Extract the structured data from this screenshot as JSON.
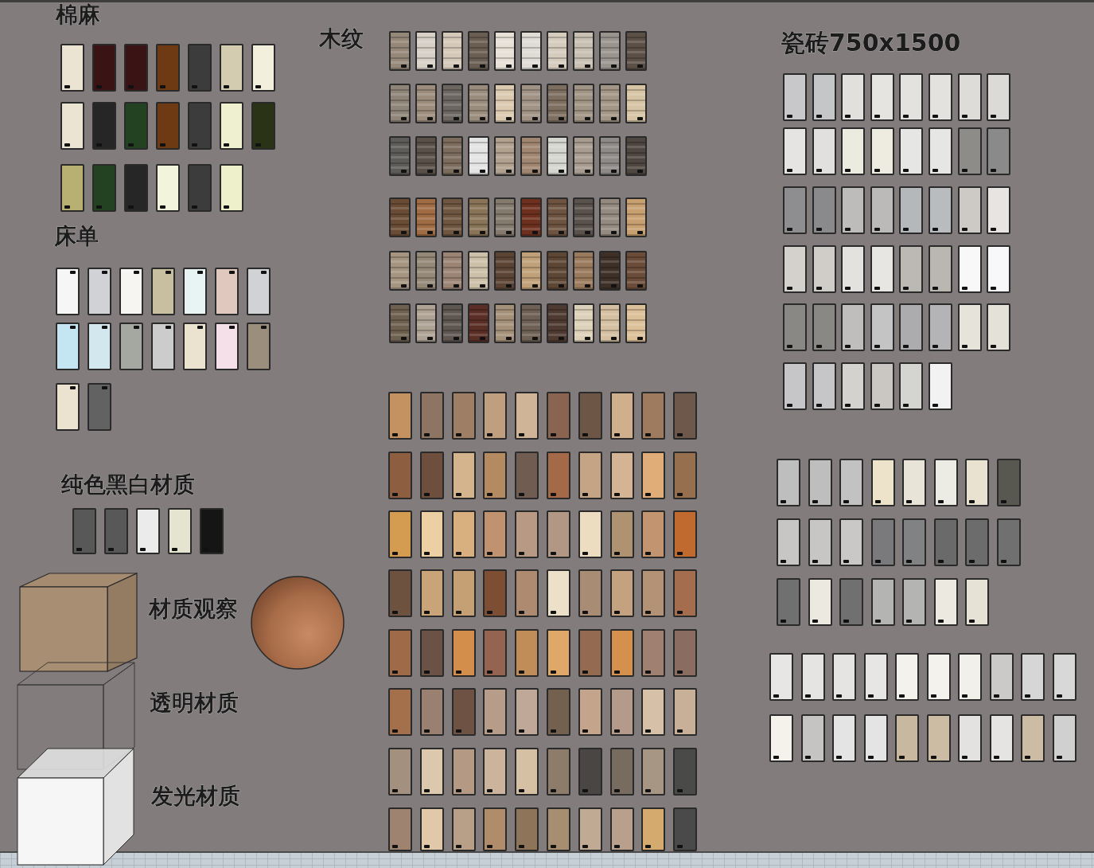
{
  "groups": [
    {
      "title": "棉麻",
      "kind": "flat",
      "rows": [
        [
          {
            "color": "#ece4d2"
          },
          {
            "color": "#3a1414"
          },
          {
            "color": "#3a1414"
          },
          {
            "color": "#6e3a14"
          },
          {
            "color": "#3c3c3c"
          },
          {
            "color": "#d3ccb0"
          },
          {
            "color": "#f2f0dc"
          }
        ],
        [
          {
            "color": "#ece4d2"
          },
          {
            "color": "#262626"
          },
          {
            "color": "#234222"
          },
          {
            "color": "#6e3a14"
          },
          {
            "color": "#3c3c3c"
          },
          {
            "color": "#eef0d0"
          },
          {
            "color": "#2a3316"
          }
        ],
        [
          {
            "color": "#b8b072"
          },
          {
            "color": "#234222"
          },
          {
            "color": "#262626"
          },
          {
            "color": "#f2f4dc"
          },
          {
            "color": "#3c3c3c"
          },
          {
            "color": "#eef0cc"
          }
        ]
      ]
    },
    {
      "title": "床单",
      "kind": "flat",
      "rows": [
        [
          {
            "color": "#f6f6f6"
          },
          {
            "color": "#d0d2d6"
          },
          {
            "color": "#f6f5f2"
          },
          {
            "color": "#c7bf9f"
          },
          {
            "color": "#e8f4f4"
          },
          {
            "color": "#e1c8bf"
          },
          {
            "color": "#d0d2d6"
          }
        ],
        [
          {
            "color": "#c4e6f2"
          },
          {
            "color": "#d2e8ee"
          },
          {
            "color": "#a4a8a0"
          },
          {
            "color": "#cccccc"
          },
          {
            "color": "#ebe3cf"
          },
          {
            "color": "#f5e0ea"
          },
          {
            "color": "#9b8e7c"
          }
        ],
        [
          {
            "color": "#ebe3cf"
          },
          {
            "color": "#626262"
          }
        ]
      ]
    },
    {
      "title": "纯色黑白材质",
      "kind": "flat",
      "rows": [
        [
          {
            "color": "#585858"
          },
          {
            "color": "#585858"
          },
          {
            "color": "#ebebeb"
          },
          {
            "color": "#e4e4d0"
          },
          {
            "color": "#151515"
          }
        ]
      ]
    },
    {
      "title": "木纹",
      "kind": "striped",
      "rows": [
        [
          {
            "color": "#958878"
          },
          {
            "color": "#d6d0c6"
          },
          {
            "color": "#d4c8b8"
          },
          {
            "color": "#6a5e52"
          },
          {
            "color": "#e6e0d6"
          },
          {
            "color": "#dedcd4"
          },
          {
            "color": "#d6ccbe"
          },
          {
            "color": "#c8c0b2"
          },
          {
            "color": "#9a948e"
          },
          {
            "color": "#5c5046"
          }
        ],
        [
          {
            "color": "#8e8478"
          },
          {
            "color": "#9c8c7c"
          },
          {
            "color": "#6c6660"
          },
          {
            "color": "#9a8c7c"
          },
          {
            "color": "#dccab0"
          },
          {
            "color": "#a09284"
          },
          {
            "color": "#7e6e60"
          },
          {
            "color": "#a09484"
          },
          {
            "color": "#a49686"
          },
          {
            "color": "#d6c4a4"
          }
        ],
        [
          {
            "color": "#5e5c58"
          },
          {
            "color": "#5a5048"
          },
          {
            "color": "#7c6c5e"
          },
          {
            "color": "#e4e4e4"
          },
          {
            "color": "#b0a08e"
          },
          {
            "color": "#a08670"
          },
          {
            "color": "#d6d6d0"
          },
          {
            "color": "#a89c90"
          },
          {
            "color": "#8e8a88"
          },
          {
            "color": "#4e4640"
          }
        ],
        [
          {
            "color": "#6a4c34"
          },
          {
            "color": "#a06c44"
          },
          {
            "color": "#6e5640"
          },
          {
            "color": "#8a7458"
          },
          {
            "color": "#847a6e"
          },
          {
            "color": "#6e301e"
          },
          {
            "color": "#6e5440"
          },
          {
            "color": "#5a524c"
          },
          {
            "color": "#948a80"
          },
          {
            "color": "#c8a070"
          }
        ],
        [
          {
            "color": "#a49480"
          },
          {
            "color": "#948878"
          },
          {
            "color": "#9c8474"
          },
          {
            "color": "#ccc0a8"
          },
          {
            "color": "#5c4434"
          },
          {
            "color": "#c0a078"
          },
          {
            "color": "#5e4634"
          },
          {
            "color": "#9a7a5c"
          },
          {
            "color": "#3e3026"
          },
          {
            "color": "#6a4c38"
          }
        ],
        [
          {
            "color": "#6e604e"
          },
          {
            "color": "#aea294"
          },
          {
            "color": "#5e5650"
          },
          {
            "color": "#5a2e24"
          },
          {
            "color": "#a49078"
          },
          {
            "color": "#6e6054"
          },
          {
            "color": "#4e3a30"
          },
          {
            "color": "#dcd0b8"
          },
          {
            "color": "#d4c0a0"
          },
          {
            "color": "#dcc098"
          }
        ]
      ]
    },
    {
      "kind": "flat",
      "rows": [
        [
          {
            "color": "#c49260"
          },
          {
            "color": "#8e7462"
          },
          {
            "color": "#9e7e64"
          },
          {
            "color": "#c09e80"
          },
          {
            "color": "#d0b498"
          },
          {
            "color": "#8a6450"
          },
          {
            "color": "#6e5646"
          },
          {
            "color": "#d0b08c"
          },
          {
            "color": "#9e7a5e"
          },
          {
            "color": "#6e584c"
          }
        ],
        [
          {
            "color": "#8e5e40"
          },
          {
            "color": "#6e4e3c"
          },
          {
            "color": "#d4b48c"
          },
          {
            "color": "#b48a60"
          },
          {
            "color": "#705c50"
          },
          {
            "color": "#a46a48"
          },
          {
            "color": "#c4a484"
          },
          {
            "color": "#d4b494"
          },
          {
            "color": "#e0ac78"
          },
          {
            "color": "#96704e"
          }
        ],
        [
          {
            "color": "#d49c50"
          },
          {
            "color": "#ecd0a4"
          },
          {
            "color": "#d8b080"
          },
          {
            "color": "#c09270"
          },
          {
            "color": "#b89a84"
          },
          {
            "color": "#b29884"
          },
          {
            "color": "#ecdcc0"
          },
          {
            "color": "#ae9272"
          },
          {
            "color": "#c29470"
          },
          {
            "color": "#c06a30"
          }
        ],
        [
          {
            "color": "#6e5240"
          },
          {
            "color": "#c8a478"
          },
          {
            "color": "#c4a074"
          },
          {
            "color": "#7e4e34"
          },
          {
            "color": "#ae8a70"
          },
          {
            "color": "#ece0c8"
          },
          {
            "color": "#a88c74"
          },
          {
            "color": "#c4a280"
          },
          {
            "color": "#b49276"
          },
          {
            "color": "#a46e4e"
          }
        ],
        [
          {
            "color": "#9e6a48"
          },
          {
            "color": "#6a5246"
          },
          {
            "color": "#d48e4c"
          },
          {
            "color": "#946450"
          },
          {
            "color": "#c08c58"
          },
          {
            "color": "#e0a868"
          },
          {
            "color": "#946a50"
          },
          {
            "color": "#d4904c"
          },
          {
            "color": "#a08070"
          },
          {
            "color": "#8a6c60"
          }
        ],
        [
          {
            "color": "#a4704c"
          },
          {
            "color": "#9a8070"
          },
          {
            "color": "#6e5244"
          },
          {
            "color": "#b89c8a"
          },
          {
            "color": "#c0a898"
          },
          {
            "color": "#74604e"
          },
          {
            "color": "#c4a48a"
          },
          {
            "color": "#b49a8a"
          },
          {
            "color": "#d6c0a8"
          },
          {
            "color": "#c8b098"
          }
        ],
        [
          {
            "color": "#a4907e"
          },
          {
            "color": "#dcc8ac"
          },
          {
            "color": "#b49a84"
          },
          {
            "color": "#ccb49c"
          },
          {
            "color": "#d6c0a4"
          },
          {
            "color": "#8e7c6a"
          },
          {
            "color": "#4a4644"
          },
          {
            "color": "#786c60"
          },
          {
            "color": "#a89684"
          },
          {
            "color": "#4a4a48"
          }
        ],
        [
          {
            "color": "#9e8470"
          },
          {
            "color": "#e0c8a8"
          },
          {
            "color": "#b8a088"
          },
          {
            "color": "#b08c6a"
          },
          {
            "color": "#8e7458"
          },
          {
            "color": "#a88e70"
          },
          {
            "color": "#c0aa94"
          },
          {
            "color": "#b8a08c"
          },
          {
            "color": "#d4aa6e"
          },
          {
            "color": "#4a4a4a"
          }
        ]
      ]
    },
    {
      "title": "瓷砖750x1500",
      "kind": "flat",
      "rows": [
        [
          {
            "color": "#c8c8ca"
          },
          {
            "color": "#c4c6c8"
          },
          {
            "color": "#e2e0dc"
          },
          {
            "color": "#e6e4e0"
          },
          {
            "color": "#e4e2de"
          },
          {
            "color": "#e4e2de"
          },
          {
            "color": "#dedcd8"
          },
          {
            "color": "#dcdad6"
          }
        ],
        [
          {
            "color": "#e6e4e2"
          },
          {
            "color": "#e2e0de"
          },
          {
            "color": "#ecebe0"
          },
          {
            "color": "#eeebe0"
          },
          {
            "color": "#e6e6e4"
          },
          {
            "color": "#e6e6e4"
          },
          {
            "color": "#8e8c88"
          },
          {
            "color": "#8a8a8a"
          }
        ],
        [
          {
            "color": "#8e8e90"
          },
          {
            "color": "#8a8a8c"
          },
          {
            "color": "#bebcba"
          },
          {
            "color": "#bcbab8"
          },
          {
            "color": "#b4b8ba"
          },
          {
            "color": "#b8bcbe"
          },
          {
            "color": "#cdc9c4"
          },
          {
            "color": "#e8e4e2"
          }
        ],
        [
          {
            "color": "#d4d0cc"
          },
          {
            "color": "#d0ccc8"
          },
          {
            "color": "#e4e2de"
          },
          {
            "color": "#e8e6e2"
          },
          {
            "color": "#bcb8b4"
          },
          {
            "color": "#bab6b0"
          },
          {
            "color": "#f8f8f8"
          },
          {
            "color": "#f8f8fa"
          }
        ],
        [
          {
            "color": "#8a8884"
          },
          {
            "color": "#8a8884"
          },
          {
            "color": "#c0bebc"
          },
          {
            "color": "#c4c4c4"
          },
          {
            "color": "#acacae"
          },
          {
            "color": "#b4b4b6"
          },
          {
            "color": "#e6e4da"
          },
          {
            "color": "#e4e2d8"
          }
        ],
        [
          {
            "color": "#c6c6c8"
          },
          {
            "color": "#c6c6c8"
          },
          {
            "color": "#d4d2ce"
          },
          {
            "color": "#cac6c2"
          },
          {
            "color": "#d4d4d0"
          },
          {
            "color": "#f2f2f2"
          }
        ]
      ]
    },
    {
      "kind": "flat",
      "rows": [
        [
          {
            "color": "#bebebe"
          },
          {
            "color": "#bebebe"
          },
          {
            "color": "#c2c2c2"
          },
          {
            "color": "#ede3ca"
          },
          {
            "color": "#e8e4d8"
          },
          {
            "color": "#ecebe4"
          },
          {
            "color": "#e9e2d0"
          },
          {
            "color": "#585850"
          }
        ],
        [
          {
            "color": "#c8c6c4"
          },
          {
            "color": "#c8c6c4"
          },
          {
            "color": "#cac8c6"
          },
          {
            "color": "#7a7a7c"
          },
          {
            "color": "#808284"
          },
          {
            "color": "#6a6a6a"
          },
          {
            "color": "#6c6c6c"
          },
          {
            "color": "#707070"
          }
        ],
        [
          {
            "color": "#707070"
          },
          {
            "color": "#ebe9e0"
          },
          {
            "color": "#707070"
          },
          {
            "color": "#b4b4b2"
          },
          {
            "color": "#b4b4b2"
          },
          {
            "color": "#ebe9e0"
          },
          {
            "color": "#e6e2d6"
          }
        ]
      ]
    },
    {
      "kind": "flat",
      "rows": [
        [
          {
            "color": "#e8e6e4"
          },
          {
            "color": "#e6e4e2"
          },
          {
            "color": "#e6e4e2"
          },
          {
            "color": "#e8e6e4"
          },
          {
            "color": "#f4f2ec"
          },
          {
            "color": "#f4f2ec"
          },
          {
            "color": "#f2f0ea"
          },
          {
            "color": "#cccac8"
          },
          {
            "color": "#d6d6d6"
          },
          {
            "color": "#d8d8d8"
          }
        ],
        [
          {
            "color": "#f4f2ea"
          },
          {
            "color": "#c6c4c2"
          },
          {
            "color": "#e4e4e4"
          },
          {
            "color": "#e4e4e4"
          },
          {
            "color": "#c8b8a0"
          },
          {
            "color": "#ccbca4"
          },
          {
            "color": "#e4e2e0"
          },
          {
            "color": "#e6e4e2"
          },
          {
            "color": "#ccbca4"
          },
          {
            "color": "#d0d0d0"
          }
        ]
      ]
    }
  ],
  "preview_labels": [
    "材质观察",
    "透明材质",
    "发光材质"
  ]
}
